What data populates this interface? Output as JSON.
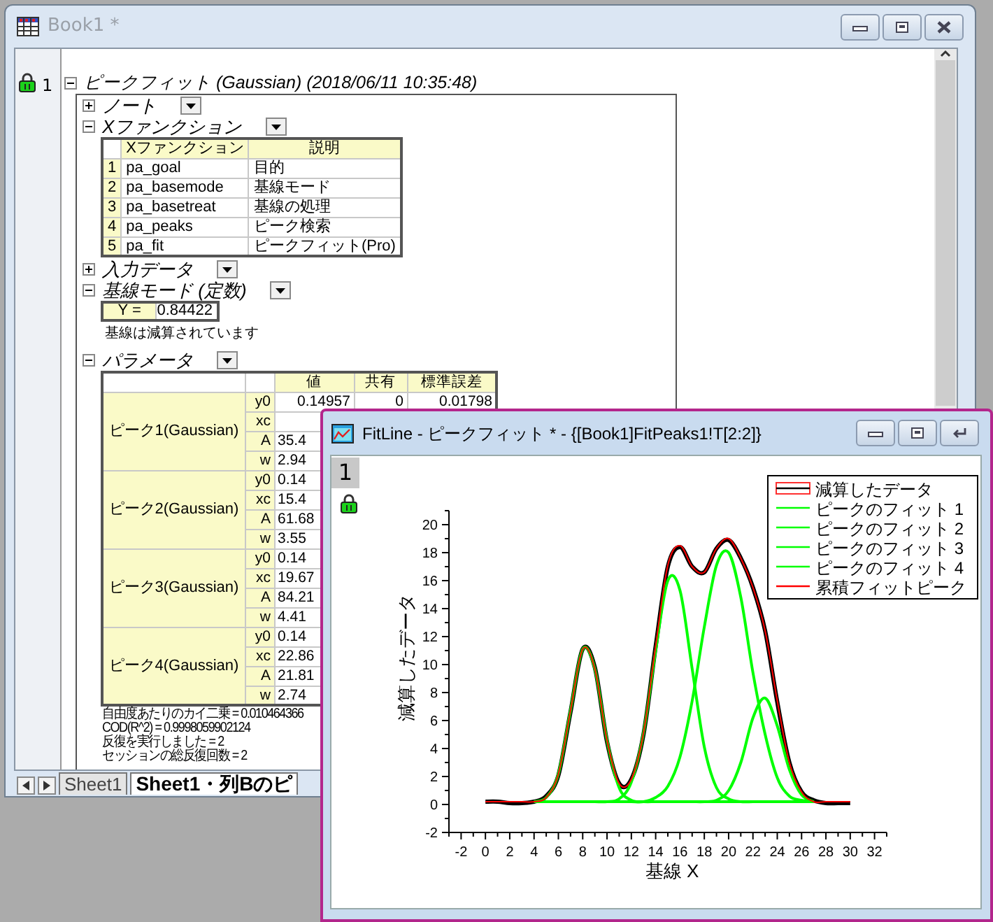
{
  "book_window": {
    "title": "Book1 *",
    "report": {
      "row_number": "1",
      "title": "ピークフィット (Gaussian) (2018/06/11 10:35:48)",
      "expanded": true,
      "sections": [
        {
          "label": "ノート",
          "expanded": false
        },
        {
          "kind": "table",
          "label": "Xファンクション",
          "expanded": true,
          "columns": [
            "Xファンクション",
            "説明"
          ],
          "rows": [
            {
              "index": "1",
              "cells": [
                "pa_goal",
                "目的"
              ]
            },
            {
              "index": "2",
              "cells": [
                "pa_basemode",
                "基線モード"
              ]
            },
            {
              "index": "3",
              "cells": [
                "pa_basetreat",
                "基線の処理"
              ]
            },
            {
              "index": "4",
              "cells": [
                "pa_peaks",
                "ピーク検索"
              ]
            },
            {
              "index": "5",
              "cells": [
                "pa_fit",
                "ピークフィット(Pro)"
              ]
            }
          ]
        },
        {
          "label": "入力データ",
          "expanded": false
        },
        {
          "kind": "value",
          "label": "基線モード (定数)",
          "expanded": true,
          "field_label": "Y =",
          "field_value": "0.84422",
          "note": "基線は減算されています"
        },
        {
          "kind": "params",
          "label": "パラメータ",
          "expanded": true,
          "columns": [
            "値",
            "共有",
            "標準誤差"
          ],
          "groups": [
            {
              "label": "ピーク1(Gaussian)",
              "rows": [
                {
                  "param": "y0",
                  "values": [
                    "0.14957",
                    "0",
                    "0.01798"
                  ]
                },
                {
                  "param": "xc",
                  "values": []
                },
                {
                  "param": "A",
                  "values": [
                    "35.4"
                  ]
                },
                {
                  "param": "w",
                  "values": [
                    "2.94"
                  ]
                }
              ]
            },
            {
              "label": "ピーク2(Gaussian)",
              "rows": [
                {
                  "param": "y0",
                  "values": [
                    "0.14"
                  ]
                },
                {
                  "param": "xc",
                  "values": [
                    "15.4"
                  ]
                },
                {
                  "param": "A",
                  "values": [
                    "61.68"
                  ]
                },
                {
                  "param": "w",
                  "values": [
                    "3.55"
                  ]
                }
              ]
            },
            {
              "label": "ピーク3(Gaussian)",
              "rows": [
                {
                  "param": "y0",
                  "values": [
                    "0.14"
                  ]
                },
                {
                  "param": "xc",
                  "values": [
                    "19.67"
                  ]
                },
                {
                  "param": "A",
                  "values": [
                    "84.21"
                  ]
                },
                {
                  "param": "w",
                  "values": [
                    "4.41"
                  ]
                }
              ]
            },
            {
              "label": "ピーク4(Gaussian)",
              "rows": [
                {
                  "param": "y0",
                  "values": [
                    "0.14"
                  ]
                },
                {
                  "param": "xc",
                  "values": [
                    "22.86"
                  ]
                },
                {
                  "param": "A",
                  "values": [
                    "21.81"
                  ]
                },
                {
                  "param": "w",
                  "values": [
                    "2.74"
                  ]
                }
              ]
            }
          ]
        }
      ],
      "footnotes": [
        "自由度あたりのカイ二乗 = 0.010464366",
        "COD(R^2) = 0.9998059902124",
        "反復を実行しました = 2",
        "セッションの総反復回数 = 2"
      ]
    },
    "sheet_tabs": [
      {
        "label": "Sheet1",
        "selected": false
      },
      {
        "label": "Sheet1・列Bのピ",
        "selected": true
      }
    ]
  },
  "fitline_window": {
    "title": "FitLine - ピークフィット * - {[Book1]FitPeaks1!T[2:2]}",
    "layer": "1",
    "chart_data": {
      "type": "line",
      "xlabel": "基線 X",
      "ylabel": "減算したデータ",
      "x": [
        0,
        1,
        2,
        3,
        4,
        5,
        6,
        7,
        8,
        9,
        10,
        11,
        12,
        13,
        14,
        15,
        16,
        17,
        18,
        19,
        20,
        21,
        22,
        23,
        24,
        25,
        26,
        27,
        28,
        29,
        30
      ],
      "xlim": [
        -3,
        33
      ],
      "ylim": [
        -2,
        21
      ],
      "xticks": [
        -2,
        0,
        2,
        4,
        6,
        8,
        10,
        12,
        14,
        16,
        18,
        20,
        22,
        24,
        26,
        28,
        30,
        32
      ],
      "yticks": [
        -2,
        0,
        2,
        4,
        6,
        8,
        10,
        12,
        14,
        16,
        18,
        20
      ],
      "legend": "upper right",
      "series": [
        {
          "name": "減算したデータ",
          "color": "#000000",
          "values": [
            0.2,
            0.2,
            0.1,
            0.1,
            0.2,
            0.6,
            2.1,
            6.6,
            11.1,
            9.8,
            4.5,
            1.5,
            1.8,
            5.0,
            11.3,
            17.0,
            18.4,
            17.0,
            16.6,
            18.3,
            18.9,
            17.6,
            15.5,
            12.4,
            7.3,
            3.0,
            0.9,
            0.3,
            0.1,
            0.1,
            0.1
          ]
        },
        {
          "name": "ピークのフィット 1",
          "color": "#00ff00",
          "values": [
            null,
            null,
            null,
            null,
            0.2,
            0.5,
            2.2,
            6.7,
            11.1,
            9.7,
            4.6,
            1.2,
            0.3,
            0.2,
            0.2,
            0.2,
            0.2,
            0.2,
            0.2,
            0.2,
            0.2,
            0.2,
            0.2,
            0.2,
            0.2,
            0.2,
            0.2,
            0.2,
            null,
            null,
            null
          ]
        },
        {
          "name": "ピークのフィット 2",
          "color": "#00ff00",
          "values": [
            null,
            null,
            null,
            null,
            0.2,
            0.2,
            0.2,
            0.2,
            0.2,
            0.2,
            0.2,
            0.4,
            1.6,
            5.1,
            11.0,
            16.0,
            15.3,
            9.7,
            4.1,
            1.2,
            0.4,
            0.2,
            0.2,
            0.2,
            0.2,
            0.2,
            0.2,
            0.2,
            null,
            null,
            null
          ]
        },
        {
          "name": "ピークのフィット 3",
          "color": "#00ff00",
          "values": [
            null,
            null,
            null,
            null,
            0.2,
            0.2,
            0.2,
            0.2,
            0.2,
            0.2,
            0.2,
            0.2,
            0.2,
            0.2,
            0.5,
            1.3,
            3.4,
            7.4,
            12.7,
            17.1,
            18.0,
            14.8,
            9.4,
            5.0,
            1.9,
            0.6,
            0.3,
            0.2,
            null,
            null,
            null
          ]
        },
        {
          "name": "ピークのフィット 4",
          "color": "#00ff00",
          "values": [
            null,
            null,
            null,
            null,
            0.2,
            0.2,
            0.2,
            0.2,
            0.2,
            0.2,
            0.2,
            0.2,
            0.2,
            0.2,
            0.2,
            0.2,
            0.2,
            0.2,
            0.2,
            0.3,
            1.0,
            3.0,
            6.2,
            7.6,
            5.6,
            2.5,
            0.7,
            0.2,
            null,
            null,
            null
          ]
        },
        {
          "name": "累積フィットピーク",
          "color": "#ff0000",
          "values": [
            0.2,
            0.2,
            0.2,
            0.2,
            0.2,
            0.5,
            2.2,
            6.7,
            11.1,
            9.7,
            4.6,
            1.5,
            1.8,
            5.1,
            11.3,
            17.1,
            18.5,
            17.0,
            16.6,
            18.3,
            19.0,
            17.6,
            15.5,
            12.4,
            7.4,
            3.0,
            0.9,
            0.2,
            0.2,
            0.2,
            0.2
          ]
        }
      ]
    }
  }
}
